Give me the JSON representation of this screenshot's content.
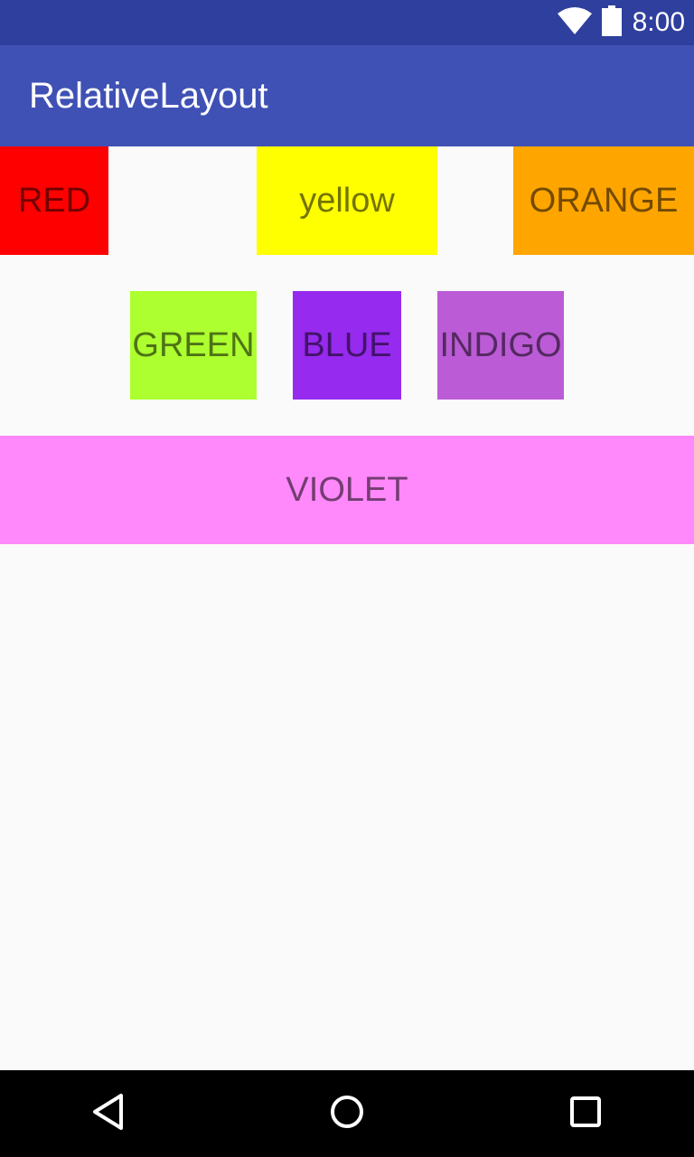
{
  "status_bar": {
    "time": "8:00",
    "icons": [
      "wifi-icon",
      "battery-icon"
    ]
  },
  "app_bar": {
    "title": "RelativeLayout"
  },
  "boxes": {
    "red": {
      "label": "RED",
      "color": "#ff0000"
    },
    "yellow": {
      "label": "yellow",
      "color": "#ffff00"
    },
    "orange": {
      "label": "ORANGE",
      "color": "#ffa500"
    },
    "green": {
      "label": "GREEN",
      "color": "#adff2f"
    },
    "blue": {
      "label": "BLUE",
      "color": "#962aee"
    },
    "indigo": {
      "label": "INDIGO",
      "color": "#bb5bd6"
    },
    "violet": {
      "label": "VIOLET",
      "color": "#ff88fb"
    }
  },
  "colors": {
    "status_bar": "#2f3f9e",
    "app_bar": "#3f51b5",
    "background": "#fafafa",
    "nav_bar": "#000000"
  },
  "nav_bar": {
    "icons": [
      "back-icon",
      "home-icon",
      "recent-apps-icon"
    ]
  }
}
